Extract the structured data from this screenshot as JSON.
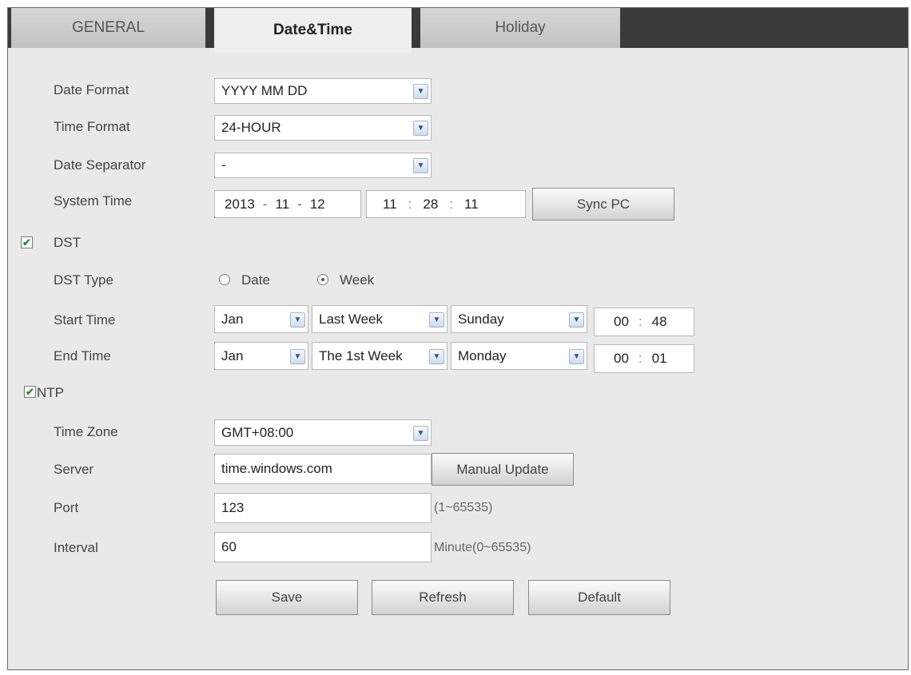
{
  "tabs": [
    "GENERAL",
    "Date&Time",
    "Holiday"
  ],
  "labels": {
    "date_format": "Date Format",
    "time_format": "Time Format",
    "date_separator": "Date Separator",
    "system_time": "System Time",
    "dst": "DST",
    "dst_type": "DST Type",
    "start_time": "Start Time",
    "end_time": "End Time",
    "ntp": "NTP",
    "time_zone": "Time Zone",
    "server": "Server",
    "port": "Port",
    "interval": "Interval"
  },
  "date_format": "YYYY MM DD",
  "time_format": "24-HOUR",
  "date_separator": "-",
  "system_time": {
    "year": "2013",
    "month": "11",
    "day": "12",
    "hour": "11",
    "minute": "28",
    "second": "11",
    "date_sep": "-",
    "time_sep": ":"
  },
  "sync_pc": "Sync PC",
  "dst_enabled": true,
  "dst_type": {
    "date": "Date",
    "week": "Week",
    "selected": "Week"
  },
  "start_time": {
    "month": "Jan",
    "week": "Last Week",
    "day": "Sunday",
    "hour": "00",
    "minute": "48"
  },
  "end_time": {
    "month": "Jan",
    "week": "The 1st Week",
    "day": "Monday",
    "hour": "00",
    "minute": "01"
  },
  "ntp_enabled": true,
  "time_zone": "GMT+08:00",
  "server": "time.windows.com",
  "manual_update": "Manual Update",
  "port": "123",
  "port_hint": "(1~65535)",
  "interval": "60",
  "interval_hint": "Minute(0~65535)",
  "buttons": {
    "save": "Save",
    "refresh": "Refresh",
    "default": "Default"
  },
  "check_mark": "✔",
  "arrow_glyph": "▼",
  "colon": ":"
}
